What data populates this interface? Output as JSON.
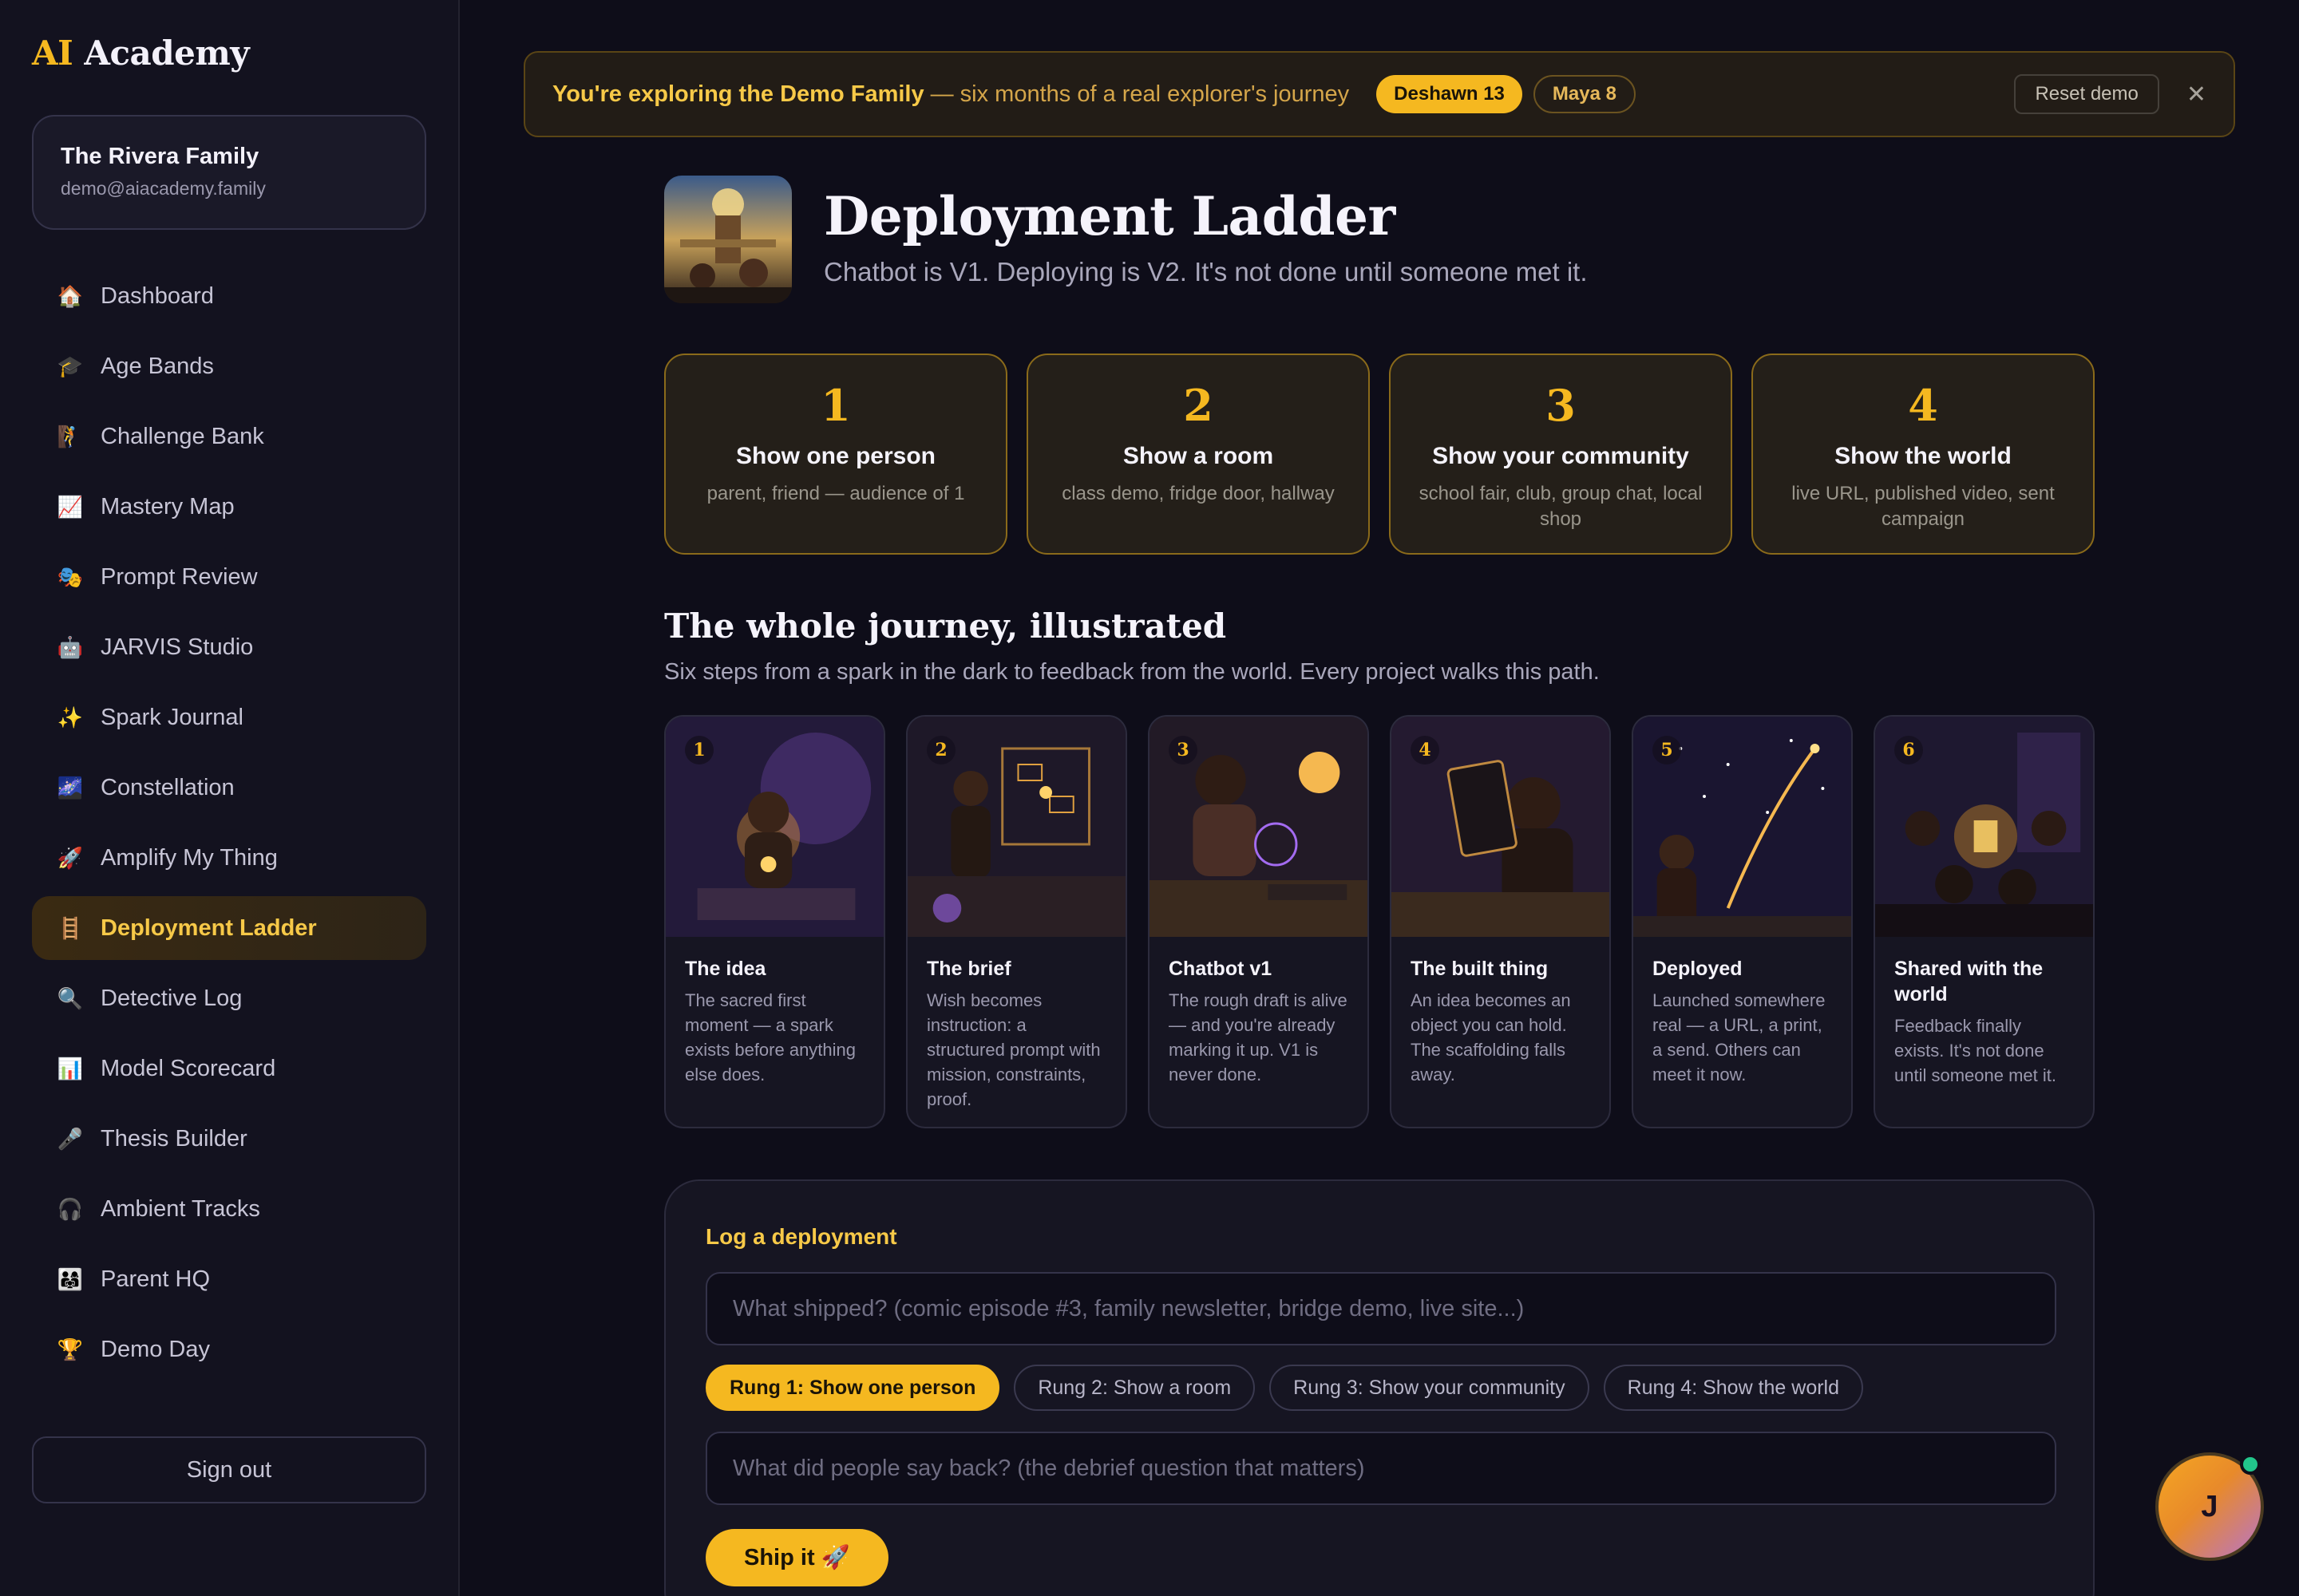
{
  "app": {
    "logo_ai": "AI",
    "logo_rest": " Academy"
  },
  "family": {
    "name": "The Rivera Family",
    "email": "demo@aiacademy.family"
  },
  "nav": [
    {
      "icon": "🏠",
      "label": "Dashboard"
    },
    {
      "icon": "🎓",
      "label": "Age Bands"
    },
    {
      "icon": "🧗",
      "label": "Challenge Bank"
    },
    {
      "icon": "📈",
      "label": "Mastery Map"
    },
    {
      "icon": "🎭",
      "label": "Prompt Review"
    },
    {
      "icon": "🤖",
      "label": "JARVIS Studio"
    },
    {
      "icon": "✨",
      "label": "Spark Journal"
    },
    {
      "icon": "🌌",
      "label": "Constellation"
    },
    {
      "icon": "🚀",
      "label": "Amplify My Thing"
    },
    {
      "icon": "🪜",
      "label": "Deployment Ladder",
      "active": true
    },
    {
      "icon": "🔍",
      "label": "Detective Log"
    },
    {
      "icon": "📊",
      "label": "Model Scorecard"
    },
    {
      "icon": "🎤",
      "label": "Thesis Builder"
    },
    {
      "icon": "🎧",
      "label": "Ambient Tracks"
    },
    {
      "icon": "👨‍👩‍👧",
      "label": "Parent HQ"
    },
    {
      "icon": "🏆",
      "label": "Demo Day"
    }
  ],
  "signout": "Sign out",
  "banner": {
    "lead": "You're exploring the Demo Family",
    "sub": "— six months of a real explorer's journey",
    "kids": [
      "Deshawn 13",
      "Maya 8"
    ],
    "reset": "Reset demo",
    "close": "✕"
  },
  "header": {
    "title": "Deployment Ladder",
    "subtitle": "Chatbot is V1. Deploying is V2. It's not done until someone met it."
  },
  "rungs": [
    {
      "num": "1",
      "title": "Show one person",
      "desc": "parent, friend — audience of 1"
    },
    {
      "num": "2",
      "title": "Show a room",
      "desc": "class demo, fridge door, hallway"
    },
    {
      "num": "3",
      "title": "Show your community",
      "desc": "school fair, club, group chat, local shop"
    },
    {
      "num": "4",
      "title": "Show the world",
      "desc": "live URL, published video, sent campaign"
    }
  ],
  "journey": {
    "title": "The whole journey, illustrated",
    "subtitle": "Six steps from a spark in the dark to feedback from the world. Every project walks this path.",
    "steps": [
      {
        "num": "1",
        "title": "The idea",
        "desc": "The sacred first moment — a spark exists before anything else does."
      },
      {
        "num": "2",
        "title": "The brief",
        "desc": "Wish becomes instruction: a structured prompt with mission, constraints, proof."
      },
      {
        "num": "3",
        "title": "Chatbot v1",
        "desc": "The rough draft is alive — and you're already marking it up. V1 is never done."
      },
      {
        "num": "4",
        "title": "The built thing",
        "desc": "An idea becomes an object you can hold. The scaffolding falls away."
      },
      {
        "num": "5",
        "title": "Deployed",
        "desc": "Launched somewhere real — a URL, a print, a send. Others can meet it now."
      },
      {
        "num": "6",
        "title": "Shared with the world",
        "desc": "Feedback finally exists. It's not done until someone met it."
      }
    ]
  },
  "log": {
    "label": "Log a deployment",
    "what_placeholder": "What shipped? (comic episode #3, family newsletter, bridge demo, live site...)",
    "rung_options": [
      "Rung 1: Show one person",
      "Rung 2: Show a room",
      "Rung 3: Show your community",
      "Rung 4: Show the world"
    ],
    "selected_rung": "Rung 1: Show one person",
    "say_placeholder": "What did people say back? (the debrief question that matters)",
    "ship_label": "Ship it 🚀"
  },
  "avatar": {
    "initial": "J",
    "online": true
  },
  "colors": {
    "accent": "#f5b820",
    "background": "#0e0d19",
    "sidebar": "#13121f",
    "online": "#22c58b"
  }
}
